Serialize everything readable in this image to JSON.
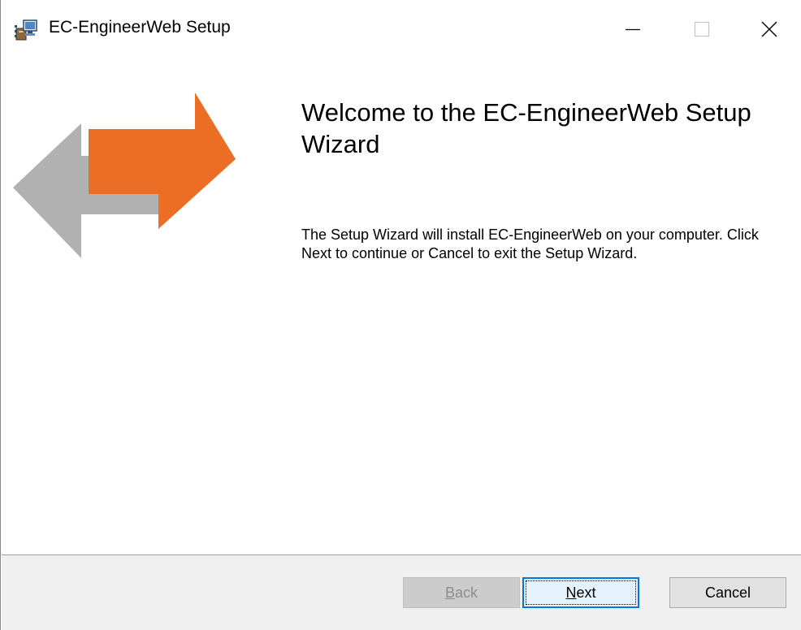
{
  "window": {
    "title": "EC-EngineerWeb Setup"
  },
  "content": {
    "heading": "Welcome to the EC-EngineerWeb Setup Wizard",
    "body": "The Setup Wizard will install EC-EngineerWeb on your computer. Click Next to continue or Cancel to exit the Setup Wizard."
  },
  "buttons": {
    "back": {
      "mnemonic": "B",
      "rest": "ack",
      "enabled": false
    },
    "next": {
      "mnemonic": "N",
      "rest": "ext",
      "focused": true
    },
    "cancel": "Cancel"
  },
  "colors": {
    "arrow_orange": "#eb6e24",
    "arrow_gray": "#b1b1b1",
    "focus_blue": "#0078d7",
    "footer_bg": "#f0f0f0"
  },
  "icons": {
    "app": "installer-package-icon",
    "banner": "bidirectional-arrows-icon",
    "minimize": "minimize-icon",
    "maximize": "maximize-icon",
    "close": "close-icon"
  }
}
